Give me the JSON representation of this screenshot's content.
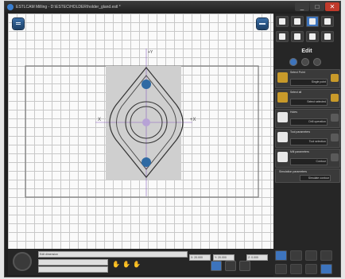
{
  "window": {
    "title": "ESTLCAM Milling - D:\\ESTEC\\HOLDER\\holder_gland.estl *",
    "buttons": [
      "_",
      "□",
      "✕"
    ]
  },
  "right_panel": {
    "section_title": "Edit",
    "operations": [
      {
        "label": "Select Point",
        "value": "Single point",
        "icon": "point-icon"
      },
      {
        "label": "Select all",
        "value": "Select selected",
        "icon": "select-icon"
      },
      {
        "label": "Holes",
        "value": "Drill operation",
        "icon": "hole-icon"
      },
      {
        "label": "Tool parameters",
        "value": "Tool selection",
        "icon": "tool-icon"
      },
      {
        "label": "Mill parameters",
        "value": "Contour",
        "icon": "mill-icon"
      },
      {
        "label": "Simulation parameters",
        "value": "Simulate contour",
        "icon": "sim-icon"
      }
    ]
  },
  "bottom": {
    "text_field": "Edit dimension",
    "coords": [
      "X: 20.000",
      "Y: 20.000",
      "Z: 0.000"
    ]
  },
  "viewport": {
    "axis_x_minus": "X",
    "axis_x_plus": "+X",
    "axis_y_plus": "+Y",
    "axis_y_minus": "-Y"
  },
  "colors": {
    "accent": "#3d74bd",
    "grid": "#c8c8c8",
    "stock_fill": "#cfcfcf",
    "hole_fill": "#2f6aa3",
    "axis": "#8a5fbf"
  }
}
